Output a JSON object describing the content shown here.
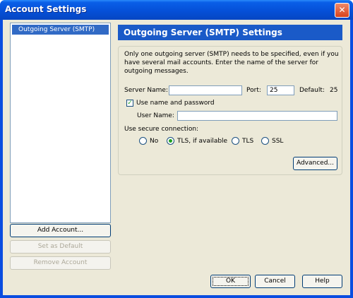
{
  "window": {
    "title": "Account Settings"
  },
  "sidebar": {
    "accounts": [
      {
        "label": "Outgoing Server (SMTP)"
      }
    ],
    "add_account_label": "Add Account...",
    "set_default_label": "Set as Default",
    "remove_account_label": "Remove Account"
  },
  "main": {
    "heading": "Outgoing Server (SMTP) Settings",
    "description": "Only one outgoing server (SMTP) needs to be specified, even if you have several mail accounts. Enter the name of the server for outgoing messages.",
    "server_name_label": "Server Name:",
    "server_name_value": "",
    "port_label": "Port:",
    "port_value": "25",
    "default_label": "Default:",
    "default_value": "25",
    "use_auth_label": "Use name and password",
    "use_auth_checked": true,
    "username_label": "User Name:",
    "username_value": "",
    "secure_label": "Use secure connection:",
    "secure_options": [
      {
        "label": "No",
        "checked": false
      },
      {
        "label": "TLS, if available",
        "checked": true
      },
      {
        "label": "TLS",
        "checked": false
      },
      {
        "label": "SSL",
        "checked": false
      }
    ],
    "advanced_label": "Advanced..."
  },
  "footer": {
    "ok_label": "OK",
    "cancel_label": "Cancel",
    "help_label": "Help"
  },
  "colors": {
    "title_bar": "#0a5fe8",
    "header_bar": "#1a5ac8",
    "selection": "#316ac5",
    "check_green": "#21a121"
  },
  "icons": {
    "close": "close-icon",
    "check": "checkmark-icon"
  }
}
